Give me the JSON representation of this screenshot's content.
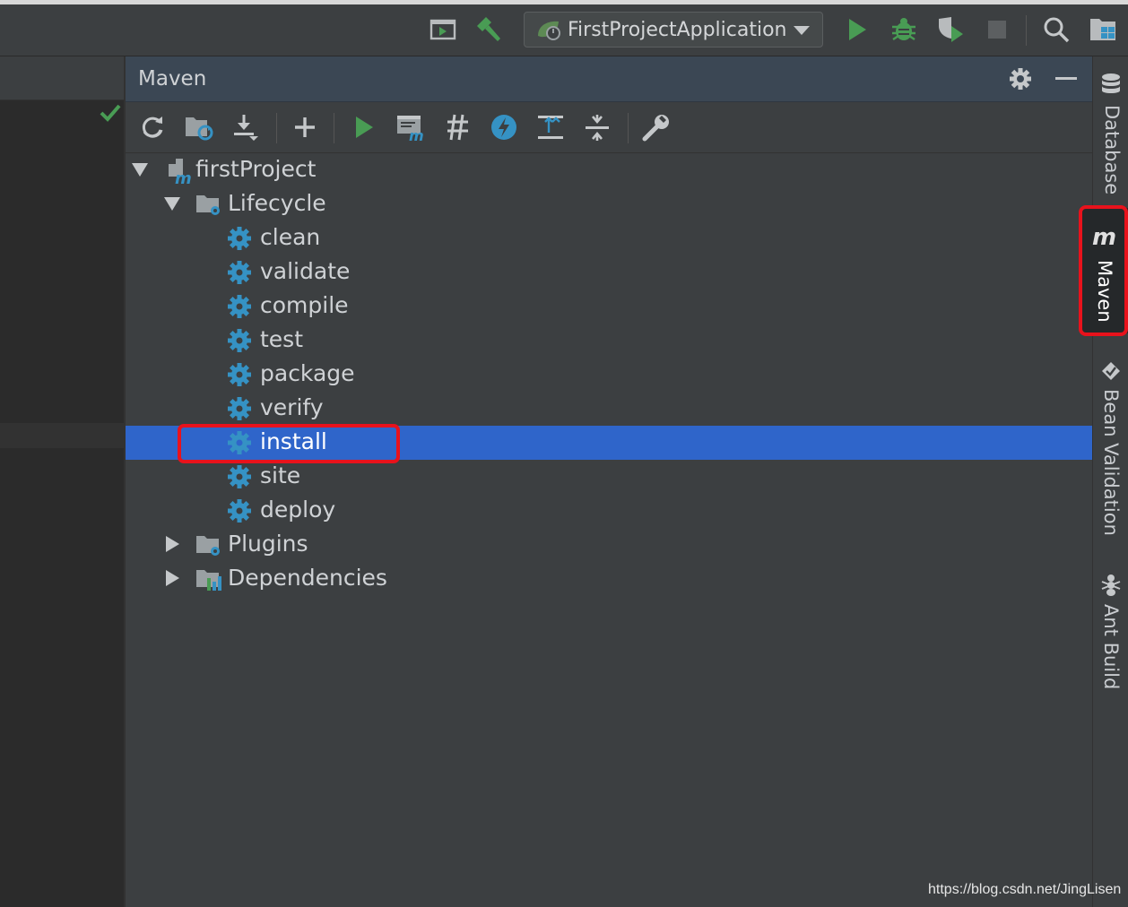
{
  "toolbar": {
    "run_configuration": "FirstProjectApplication",
    "icons": [
      "run-window-icon",
      "build-hammer-icon",
      "spring-icon",
      "run-icon",
      "debug-icon",
      "coverage-icon",
      "stop-icon",
      "search-icon",
      "project-structure-icon"
    ]
  },
  "maven_panel": {
    "title": "Maven",
    "header_icons": [
      "gear-icon",
      "minimize-icon"
    ],
    "toolbar_icons": [
      "reload-icon",
      "generate-sources-icon",
      "download-icon",
      "add-icon",
      "run-goal-icon",
      "execute-maven-goal-icon",
      "skip-tests-icon",
      "offline-mode-icon",
      "expand-all-icon",
      "collapse-all-icon",
      "maven-settings-icon"
    ],
    "tree": {
      "project": "firstProject",
      "lifecycle_label": "Lifecycle",
      "goals": [
        "clean",
        "validate",
        "compile",
        "test",
        "package",
        "verify",
        "install",
        "site",
        "deploy"
      ],
      "selected_goal": "install",
      "plugins_label": "Plugins",
      "dependencies_label": "Dependencies"
    }
  },
  "right_strip": {
    "tabs": [
      "Database",
      "Maven",
      "Bean Validation",
      "Ant Build"
    ],
    "active_tab": "Maven"
  },
  "colors": {
    "selection": "#2f65ca",
    "highlight_box": "#e8121c",
    "run_green": "#499c54",
    "gear_blue": "#3592c4"
  },
  "watermark": "https://blog.csdn.net/JingLisen"
}
